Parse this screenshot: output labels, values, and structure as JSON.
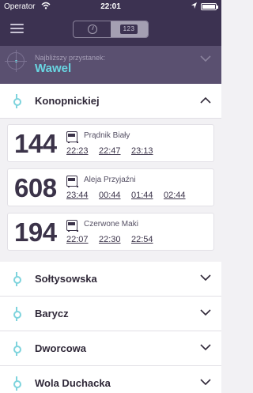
{
  "status_bar": {
    "operator": "Operator",
    "time": "22:01"
  },
  "nearest": {
    "label": "Najbliższy przystanek:",
    "name": "Wawel"
  },
  "tabs": {
    "time_label": "",
    "numbers_label": "123"
  },
  "stops": [
    {
      "name": "Konopnickiej",
      "expanded": true
    },
    {
      "name": "Sołtysowska",
      "expanded": false
    },
    {
      "name": "Barycz",
      "expanded": false
    },
    {
      "name": "Dworcowa",
      "expanded": false
    },
    {
      "name": "Wola Duchacka",
      "expanded": false
    }
  ],
  "departures": [
    {
      "line": "144",
      "destination": "Prądnik Biały",
      "times": [
        "22:23",
        "22:47",
        "23:13"
      ]
    },
    {
      "line": "608",
      "destination": "Aleja Przyjaźni",
      "times": [
        "23:44",
        "00:44",
        "01:44",
        "02:44"
      ]
    },
    {
      "line": "194",
      "destination": "Czerwone Maki",
      "times": [
        "22:07",
        "22:30",
        "22:54"
      ]
    }
  ],
  "colors": {
    "header": "#3c3251",
    "accent": "#69d6e2",
    "text": "#2f2838"
  }
}
